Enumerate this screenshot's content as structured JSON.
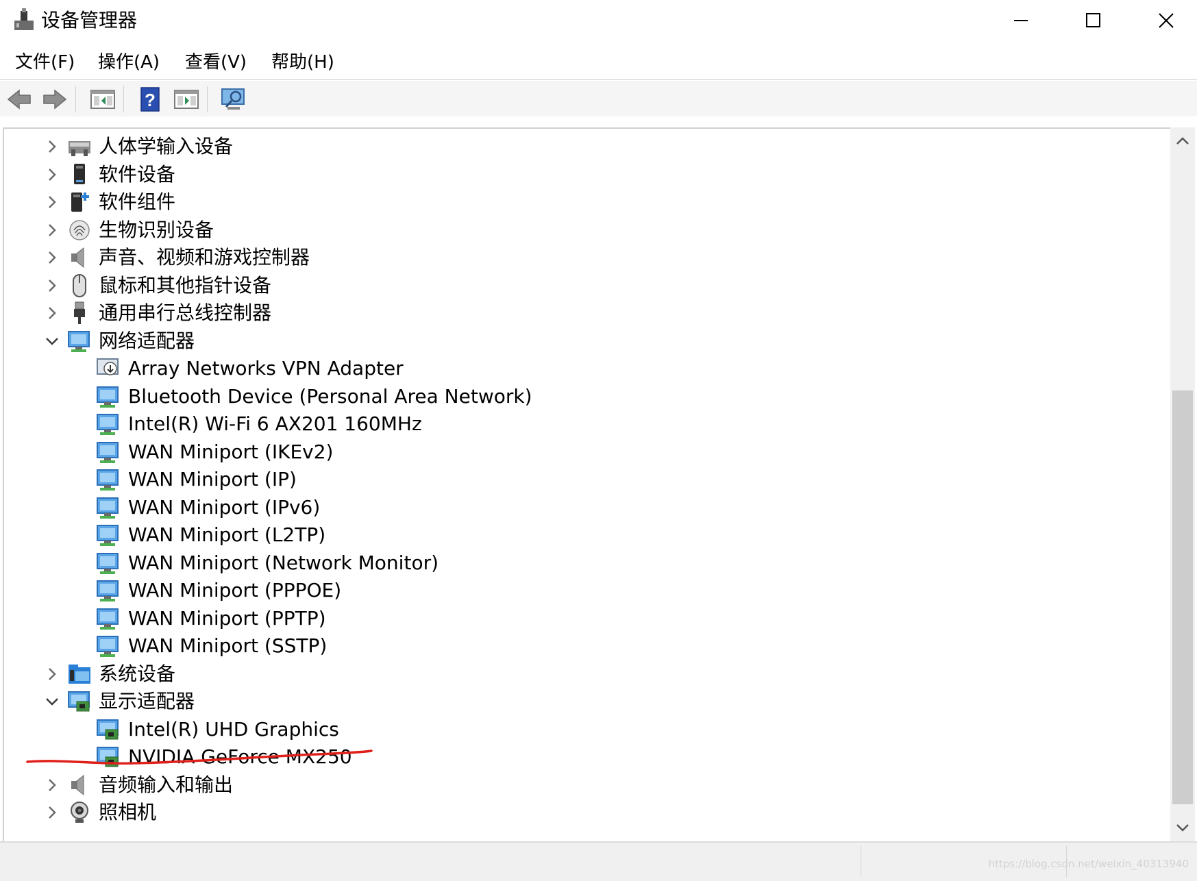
{
  "window": {
    "title": "设备管理器"
  },
  "menubar": {
    "items": [
      "文件(F)",
      "操作(A)",
      "查看(V)",
      "帮助(H)"
    ]
  },
  "toolbar": {
    "buttons": [
      "back-icon",
      "forward-icon",
      "properties-pane-icon",
      "help-icon",
      "action-pane-icon",
      "scan-hardware-monitor-icon"
    ]
  },
  "tree": {
    "items": [
      {
        "label": "人体学输入设备",
        "expanded": false,
        "icon": "human-interface-device-icon"
      },
      {
        "label": "软件设备",
        "expanded": false,
        "icon": "software-device-icon"
      },
      {
        "label": "软件组件",
        "expanded": false,
        "icon": "software-component-icon"
      },
      {
        "label": "生物识别设备",
        "expanded": false,
        "icon": "fingerprint-icon"
      },
      {
        "label": "声音、视频和游戏控制器",
        "expanded": false,
        "icon": "speaker-icon"
      },
      {
        "label": "鼠标和其他指针设备",
        "expanded": false,
        "icon": "mouse-icon"
      },
      {
        "label": "通用串行总线控制器",
        "expanded": false,
        "icon": "usb-plug-icon"
      },
      {
        "label": "网络适配器",
        "expanded": true,
        "icon": "network-adapter-icon",
        "children": [
          "Array Networks VPN Adapter",
          "Bluetooth Device (Personal Area Network)",
          "Intel(R) Wi-Fi 6 AX201 160MHz",
          "WAN Miniport (IKEv2)",
          "WAN Miniport (IP)",
          "WAN Miniport (IPv6)",
          "WAN Miniport (L2TP)",
          "WAN Miniport (Network Monitor)",
          "WAN Miniport (PPPOE)",
          "WAN Miniport (PPTP)",
          "WAN Miniport (SSTP)"
        ]
      },
      {
        "label": "系统设备",
        "expanded": false,
        "icon": "system-device-folder-icon"
      },
      {
        "label": "显示适配器",
        "expanded": true,
        "icon": "display-adapter-icon",
        "children": [
          "Intel(R) UHD Graphics",
          "NVIDIA GeForce MX250"
        ]
      },
      {
        "label": "音频输入和输出",
        "expanded": false,
        "icon": "speaker-icon"
      },
      {
        "label": "照相机",
        "expanded": false,
        "icon": "webcam-icon"
      }
    ]
  },
  "statusbar": {
    "watermark": "https://blog.csdn.net/weixin_40313940"
  },
  "colors": {
    "annotation_red": "#e0201a",
    "monitor_blue": "#2f7fd6",
    "chevron": "#6a6a6a"
  }
}
